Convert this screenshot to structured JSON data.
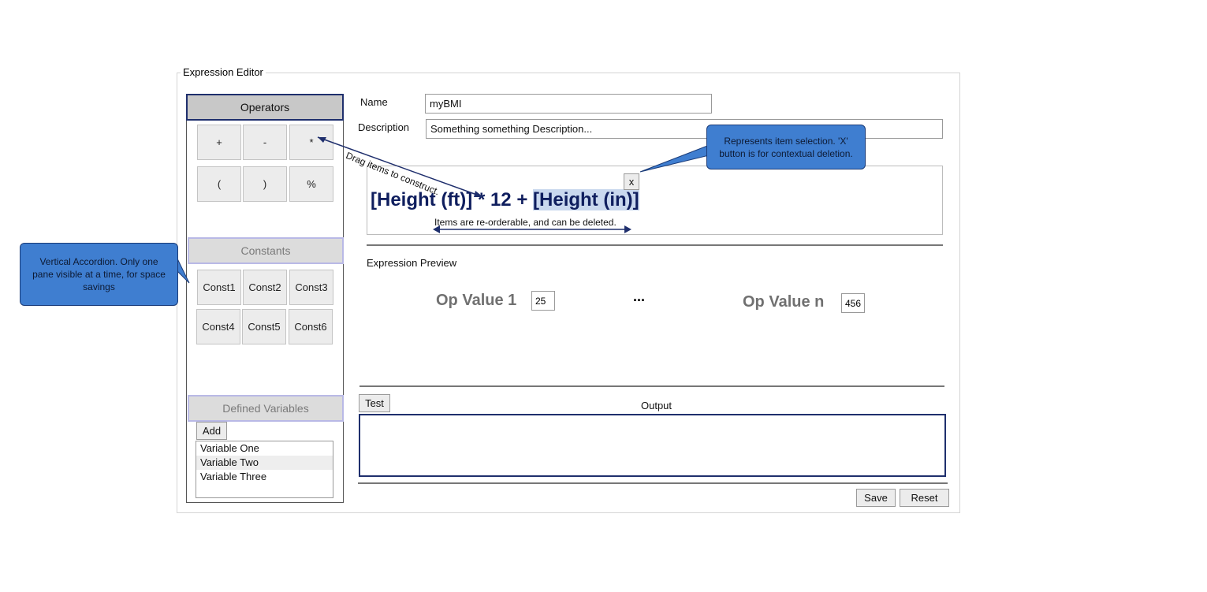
{
  "editor": {
    "title": "Expression Editor"
  },
  "operators": {
    "header": "Operators",
    "items": [
      "+",
      "-",
      "*",
      "(",
      ")",
      "%"
    ]
  },
  "constants": {
    "header": "Constants",
    "items": [
      "Const1",
      "Const2",
      "Const3",
      "Const4",
      "Const5",
      "Const6"
    ]
  },
  "variables": {
    "header": "Defined Variables",
    "add_label": "Add",
    "items": [
      "Variable One",
      "Variable Two",
      "Variable Three"
    ],
    "selected_index": 1
  },
  "form": {
    "name_label": "Name",
    "name_value": "myBMI",
    "description_label": "Description",
    "description_value": "Something something Description..."
  },
  "expression": {
    "part1": "[Height (ft)]",
    "part2": " * 12 + ",
    "part3": "[Height (in)]",
    "delete_label": "x"
  },
  "preview": {
    "title": "Expression Preview",
    "op1_label": "Op Value 1",
    "op1_value": "25",
    "ellipsis": "...",
    "opn_label": "Op Value n",
    "opn_value": "456"
  },
  "test": {
    "button_label": "Test",
    "output_label": "Output"
  },
  "actions": {
    "save_label": "Save",
    "reset_label": "Reset"
  },
  "annotations": {
    "drag_note": "Drag items to construct.",
    "reorder_note": "Items are re-orderable, and can be deleted.",
    "callout_selection": "Represents item selection.  'X' button is for contextual deletion.",
    "callout_accordion": "Vertical Accordion.  Only one pane visible at a time, for space savings"
  },
  "colors": {
    "accent_dark": "#1f2f6d",
    "callout_fill": "#3f7ed0",
    "expression_text": "#0f1e5e",
    "selection_highlight": "#c9d8ee"
  }
}
